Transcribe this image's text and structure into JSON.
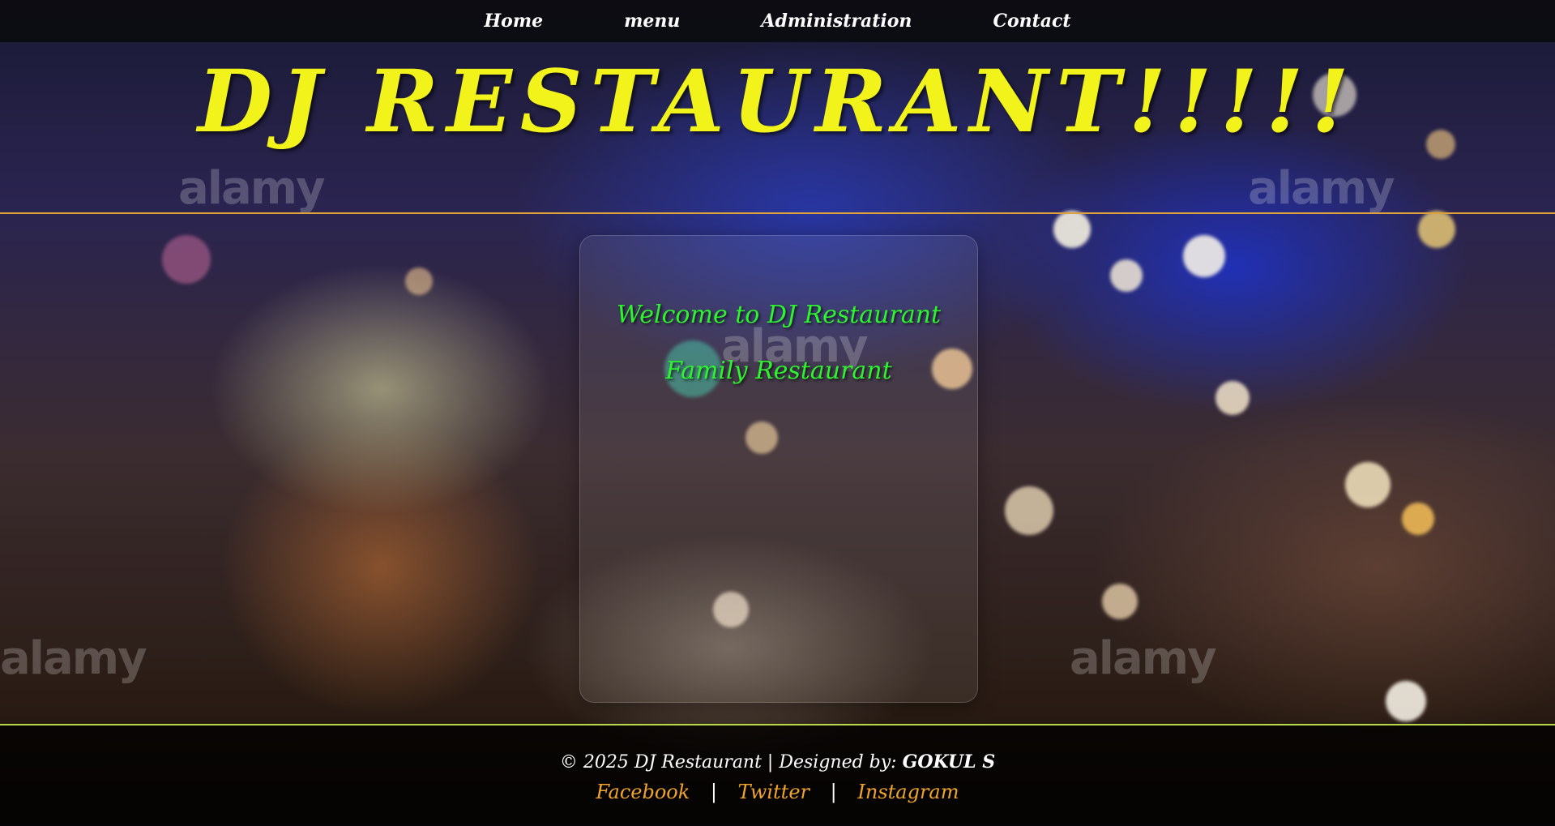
{
  "nav": {
    "items": [
      {
        "label": "Home"
      },
      {
        "label": "menu"
      },
      {
        "label": "Administration"
      },
      {
        "label": "Contact"
      }
    ]
  },
  "hero": {
    "title": "DJ RESTAURANT!!!!!"
  },
  "card": {
    "welcome": "Welcome to DJ Restaurant",
    "subtitle": "Family Restaurant"
  },
  "footer": {
    "copyright": "© 2025 DJ Restaurant | Designed by:",
    "designer": "GOKUL S",
    "links": [
      {
        "label": "Facebook"
      },
      {
        "label": "Twitter"
      },
      {
        "label": "Instagram"
      }
    ],
    "separator": "|"
  },
  "watermark": "alamy",
  "colors": {
    "title": "#f1f31a",
    "welcome_text": "#2df52d",
    "link": "#f0a52a",
    "top_rule": "#e0a23a",
    "footer_rule": "#b7d94a"
  }
}
